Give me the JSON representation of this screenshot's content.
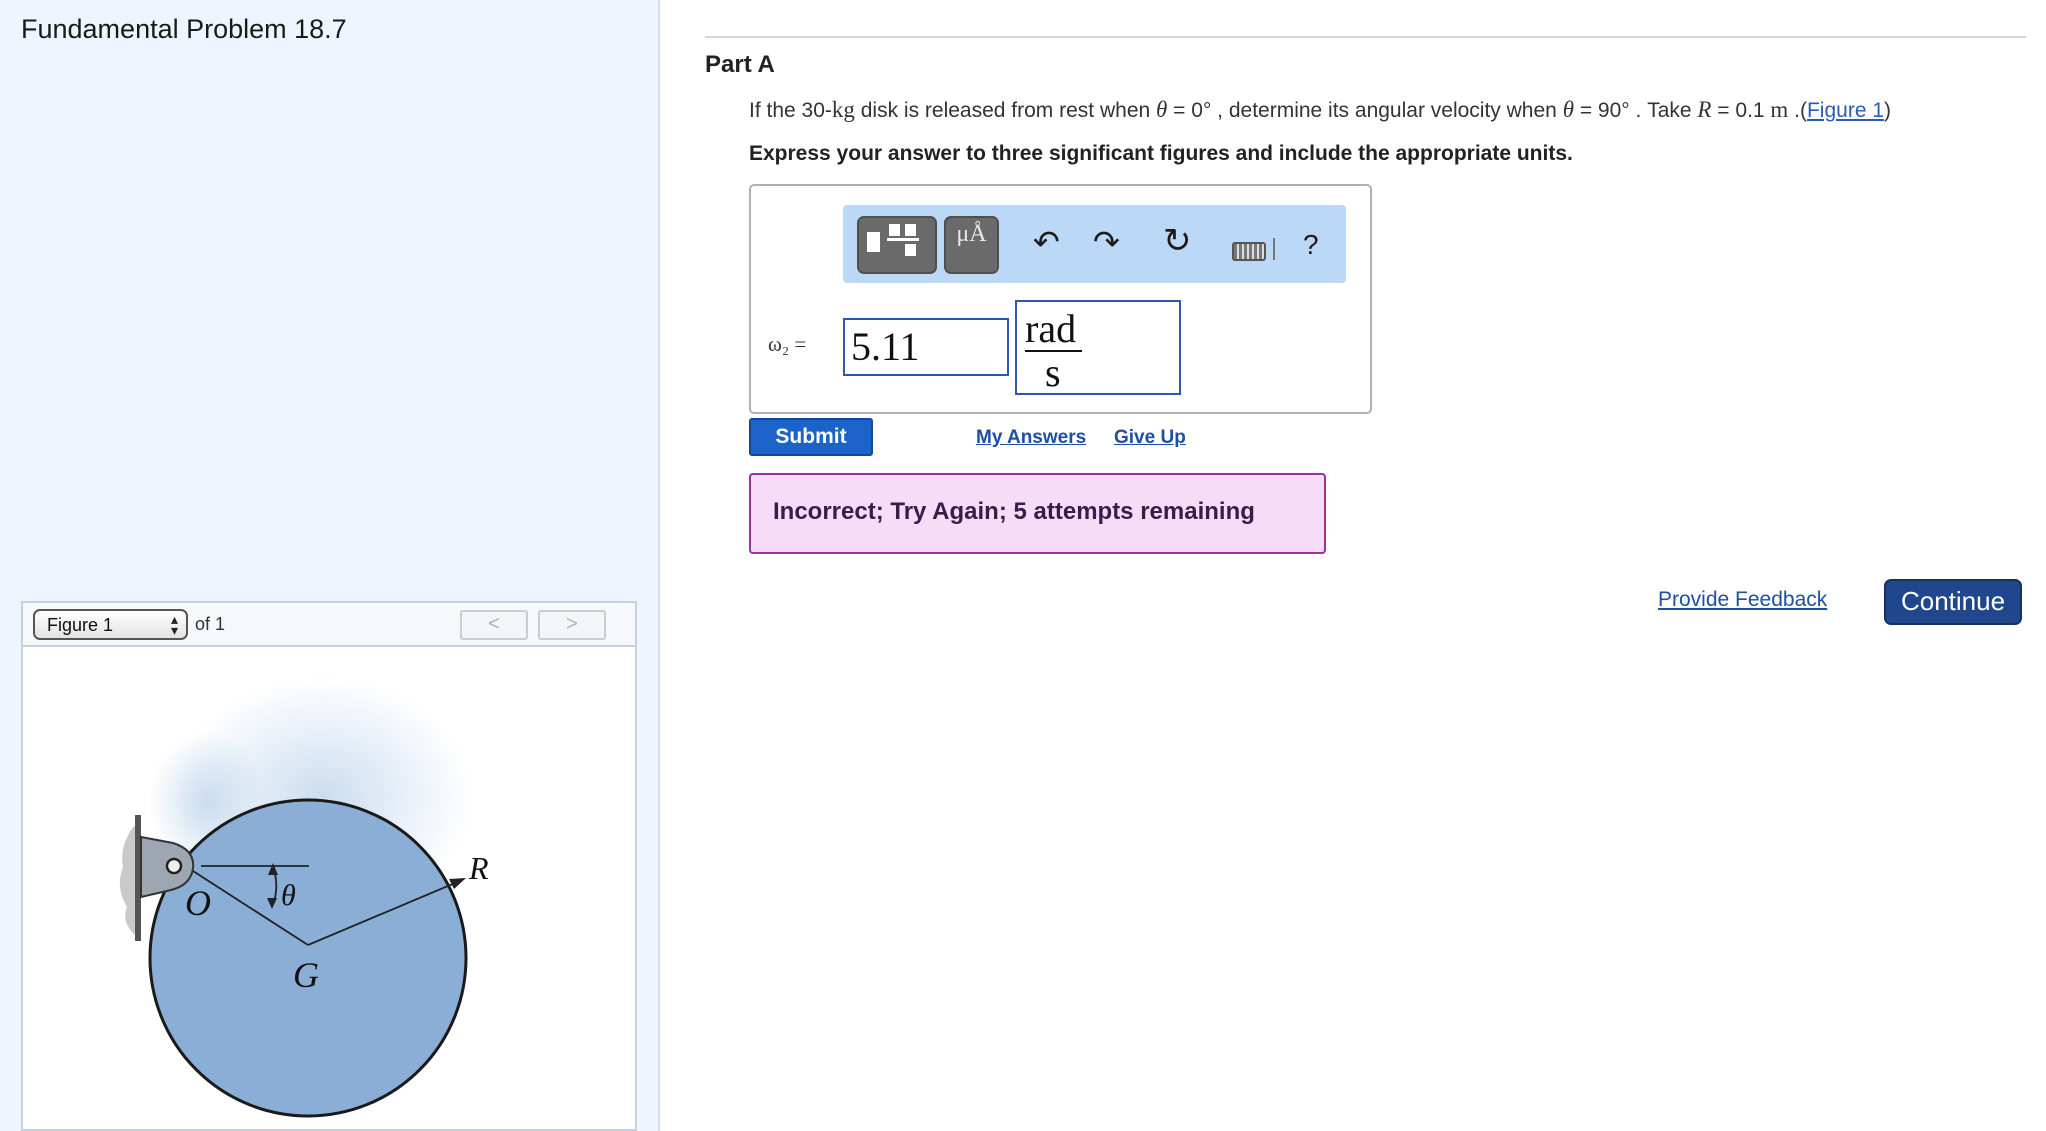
{
  "left_panel": {
    "problem_title": "Fundamental Problem 18.7",
    "figure_selector": {
      "selected": "Figure 1",
      "of_label": "of 1",
      "prev_label": "<",
      "next_label": ">"
    },
    "figure": {
      "label_O": "O",
      "label_G": "G",
      "label_R": "R",
      "label_theta": "θ",
      "disk_color": "#8baed6"
    }
  },
  "part": {
    "title": "Part A",
    "question": {
      "text_1": "If the 30-",
      "mass_unit": "kg",
      "text_2": " disk is released from rest when ",
      "theta_symbol": "θ",
      "text_3": " = 0° , determine its angular velocity when ",
      "text_4": " = 90° . Take ",
      "r_symbol": "R",
      "text_5": " = 0.1 ",
      "length_unit": "m",
      "text_6": " .(",
      "figure_link": "Figure 1",
      "text_7": ")"
    },
    "instructions": "Express your answer to three significant figures and include the appropriate units."
  },
  "answer": {
    "toolbar": {
      "units_label": "μÅ",
      "undo_icon": "undo-icon",
      "redo_icon": "redo-icon",
      "reset_icon": "reset-icon",
      "help_label": "?"
    },
    "variable_label": "ω₂ =",
    "value": "5.11",
    "unit_numerator": "rad",
    "unit_denominator": "s"
  },
  "actions": {
    "submit_label": "Submit",
    "my_answers_label": "My Answers",
    "give_up_label": "Give Up"
  },
  "feedback": {
    "message": "Incorrect; Try Again; 5 attempts remaining",
    "bg_color": "#f7dcf7",
    "border_color": "#9b2fa3"
  },
  "footer": {
    "provide_feedback_label": "Provide Feedback",
    "continue_label": "Continue",
    "accent_color": "#20478d"
  }
}
